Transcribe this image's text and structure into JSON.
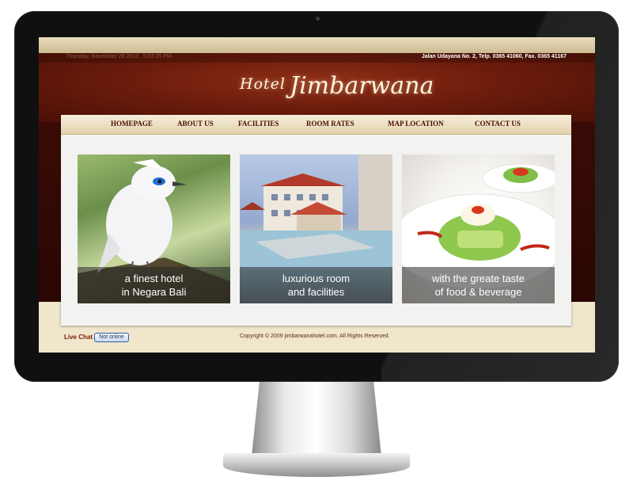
{
  "site": {
    "date_text": "Thursday, November 28 2013 , 5:03:25 PM",
    "address_prefix": "Hotel Jimbarwana",
    "address": "Jalan Udayana No. 2, Telp. 0365 41060, Fax. 0365 41167",
    "logo_small": "Hotel",
    "logo_big": "Jimbarwana"
  },
  "nav": {
    "items": [
      {
        "label": "HOMEPAGE"
      },
      {
        "label": "ABOUT US"
      },
      {
        "label": "FACILITIES"
      },
      {
        "label": "ROOM RATES"
      },
      {
        "label": "MAP LOCATION"
      },
      {
        "label": "CONTACT US"
      }
    ]
  },
  "features": [
    {
      "line1": "a finest hotel",
      "line2": "in Negara Bali"
    },
    {
      "line1": "luxurious room",
      "line2": "and facilities"
    },
    {
      "line1": "with the greate taste",
      "line2": "of food & beverage"
    }
  ],
  "footer": {
    "live_chat": "Live Chat",
    "status": "Not online",
    "copyright": "Copyright © 2009 jimbarwanahotel.com. All Rights Reserved."
  },
  "colors": {
    "header": "#6e1d0c",
    "nav_text": "#4a0f05",
    "footer_bg": "#efe6cc"
  }
}
